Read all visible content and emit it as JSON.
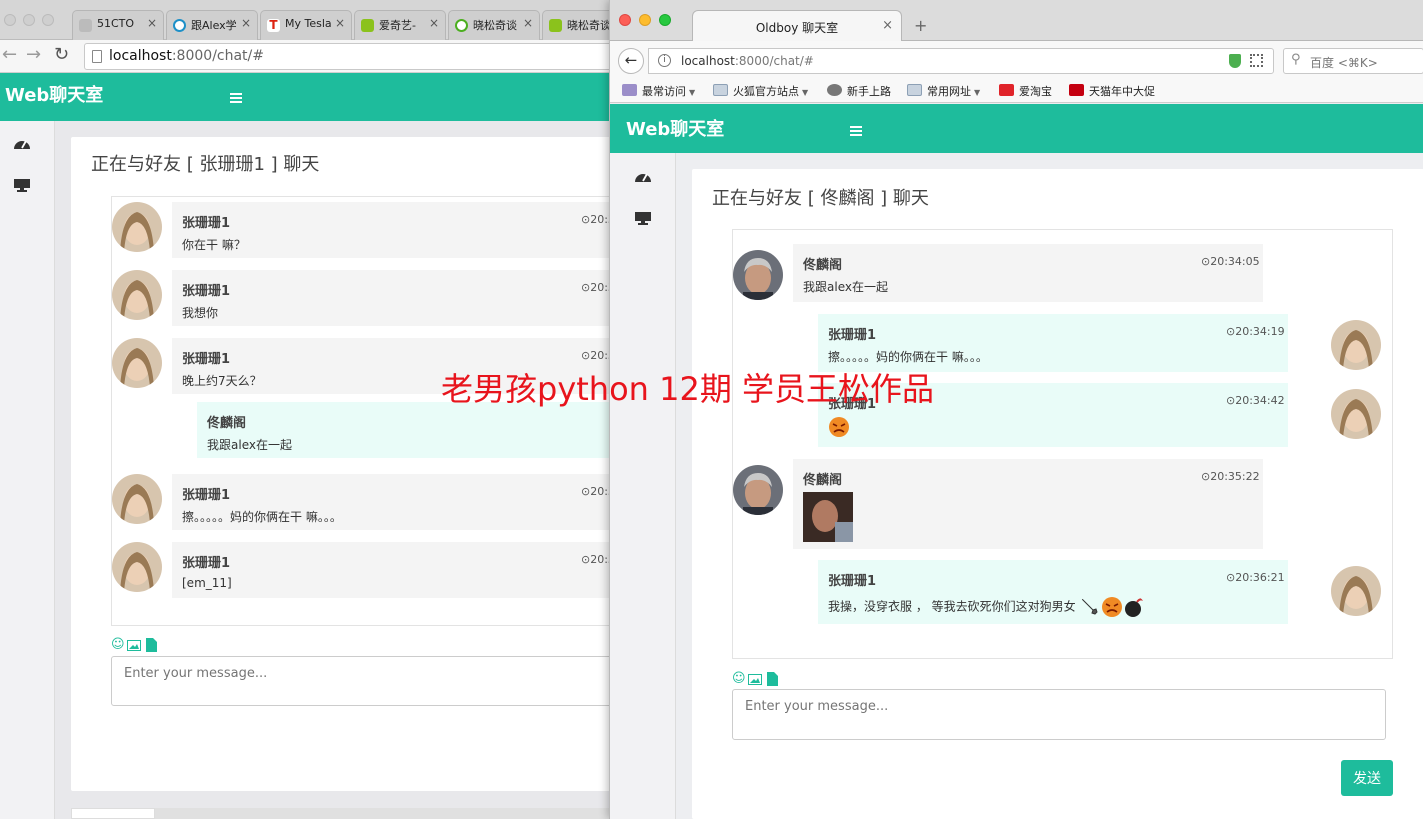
{
  "back_window": {
    "tabs": [
      {
        "label": "51CTO"
      },
      {
        "label": "跟Alex学"
      },
      {
        "label": "My Tesla"
      },
      {
        "label": "爱奇艺-"
      },
      {
        "label": "晓松奇谈"
      },
      {
        "label": "晓松奇谈"
      }
    ],
    "url_host": "localhost",
    "url_path": ":8000/chat/#",
    "brand": "Web聊天室",
    "panel_title": "正在与好友 [ 张珊珊1 ] 聊天",
    "messages": [
      {
        "name": "张珊珊1",
        "time": "⊙20:3",
        "text": "你在干 嘛？"
      },
      {
        "name": "张珊珊1",
        "time": "⊙20:3",
        "text": "我想你"
      },
      {
        "name": "张珊珊1",
        "time": "⊙20:3",
        "text": "晚上约7天么？"
      },
      {
        "name": "佟麟阁",
        "time": "",
        "text": "我跟alex在一起"
      },
      {
        "name": "张珊珊1",
        "time": "⊙20:3",
        "text": "擦。。。。。妈的你俩在干 嘛。。。"
      },
      {
        "name": "张珊珊1",
        "time": "⊙20:3",
        "text": "[em_11]"
      }
    ],
    "input_placeholder": "Enter your message..."
  },
  "front_window": {
    "tab_title": "Oldboy 聊天室",
    "url_host": "localhost",
    "url_path": ":8000/chat/#",
    "search_placeholder": "百度 <⌘K>",
    "bookmarks": [
      {
        "label": "最常访问",
        "dropdown": true
      },
      {
        "label": "火狐官方站点",
        "dropdown": true
      },
      {
        "label": "新手上路",
        "dropdown": false
      },
      {
        "label": "常用网址",
        "dropdown": true
      },
      {
        "label": "爱淘宝",
        "dropdown": false
      },
      {
        "label": "天猫年中大促",
        "dropdown": false
      }
    ],
    "brand": "Web聊天室",
    "panel_title": "正在与好友 [ 佟麟阁 ] 聊天",
    "messages": [
      {
        "name": "佟麟阁",
        "time": "⊙20:34:05",
        "text": "我跟alex在一起",
        "side": "left"
      },
      {
        "name": "张珊珊1",
        "time": "⊙20:34:19",
        "text": "擦。。。。。妈的你俩在干 嘛。。。",
        "side": "right"
      },
      {
        "name": "张珊珊1",
        "time": "⊙20:34:42",
        "text": "",
        "side": "right",
        "emoji": "angry-emoji"
      },
      {
        "name": "佟麟阁",
        "time": "⊙20:35:22",
        "text": "",
        "side": "left",
        "image": "photo-thumbnail"
      },
      {
        "name": "张珊珊1",
        "time": "⊙20:36:21",
        "text": "我操，没穿衣服 ， 等我去砍死你们这对狗男女",
        "side": "right",
        "emoji": "knife-angry-bomb"
      }
    ],
    "input_placeholder": "Enter your message...",
    "send_label": "发送"
  },
  "watermark": "老男孩python 12期 学员王松作品",
  "colors": {
    "accent": "#1ebc9c",
    "bubble_left": "#f4f4f4",
    "bubble_right": "#e9fcf8",
    "watermark": "#e8141c"
  }
}
